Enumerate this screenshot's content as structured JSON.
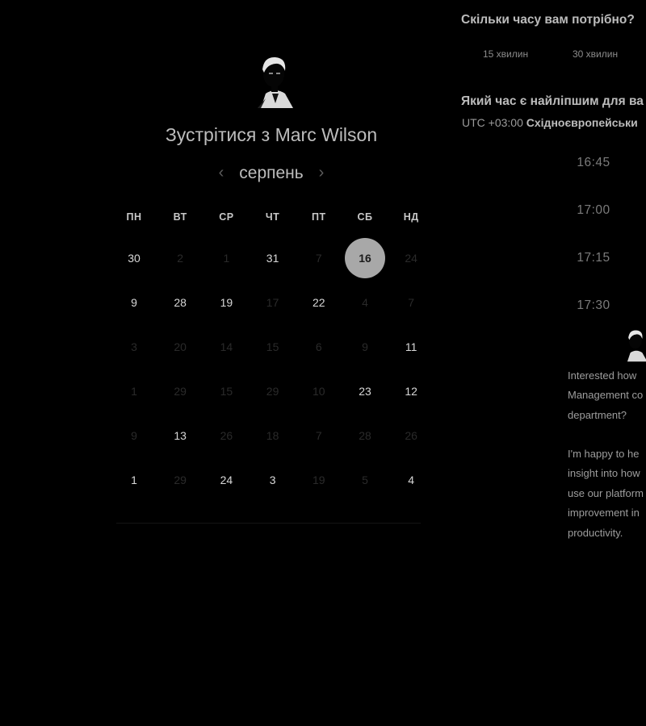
{
  "scheduler": {
    "title_prefix": "Зустрітися з",
    "host_name": "Marc Wilson",
    "month": "серпень",
    "weekdays": [
      "ПН",
      "ВТ",
      "СР",
      "ЧТ",
      "ПТ",
      "СБ",
      "НД"
    ],
    "days": [
      [
        "30",
        "2",
        "1",
        "31",
        "7",
        "16",
        "24"
      ],
      [
        "9",
        "28",
        "19",
        "17",
        "22",
        "4",
        "7"
      ],
      [
        "3",
        "20",
        "14",
        "15",
        "6",
        "9",
        "11"
      ],
      [
        "1",
        "29",
        "15",
        "29",
        "10",
        "23",
        "12"
      ],
      [
        "9",
        "13",
        "26",
        "18",
        "7",
        "28",
        "26"
      ],
      [
        "1",
        "29",
        "24",
        "3",
        "19",
        "5",
        "4"
      ]
    ],
    "available": [
      [
        true,
        false,
        false,
        true,
        false,
        true,
        false
      ],
      [
        true,
        true,
        true,
        false,
        true,
        false,
        false
      ],
      [
        false,
        false,
        false,
        false,
        false,
        false,
        true
      ],
      [
        false,
        false,
        false,
        false,
        false,
        true,
        true
      ],
      [
        false,
        true,
        false,
        false,
        false,
        false,
        false
      ],
      [
        true,
        false,
        true,
        true,
        false,
        false,
        true
      ]
    ],
    "selected_day": "16"
  },
  "duration": {
    "question": "Скільки часу вам потрібно?",
    "options": [
      "15 хвилин",
      "30 хвилин"
    ]
  },
  "time": {
    "question": "Який час є найліпшим для ва",
    "timezone_prefix": "UTC +03:00",
    "timezone_name": "Східноєвропейськи",
    "slots": [
      "16:45",
      "17:00",
      "17:15",
      "17:30"
    ]
  },
  "chat": {
    "message1_lines": [
      "Interested how",
      "Management co",
      "department?"
    ],
    "message2_lines": [
      "I'm happy to he",
      "insight into how",
      "use our platform",
      "improvement in",
      "productivity."
    ]
  },
  "colors": {
    "background": "#000000",
    "selected_day_bg": "#a8a8a8",
    "text_primary": "#d8d8d8",
    "text_dim": "#2a2a2a"
  },
  "icons": {
    "prev": "chevron-left-icon",
    "next": "chevron-right-icon",
    "avatar": "person-avatar"
  }
}
